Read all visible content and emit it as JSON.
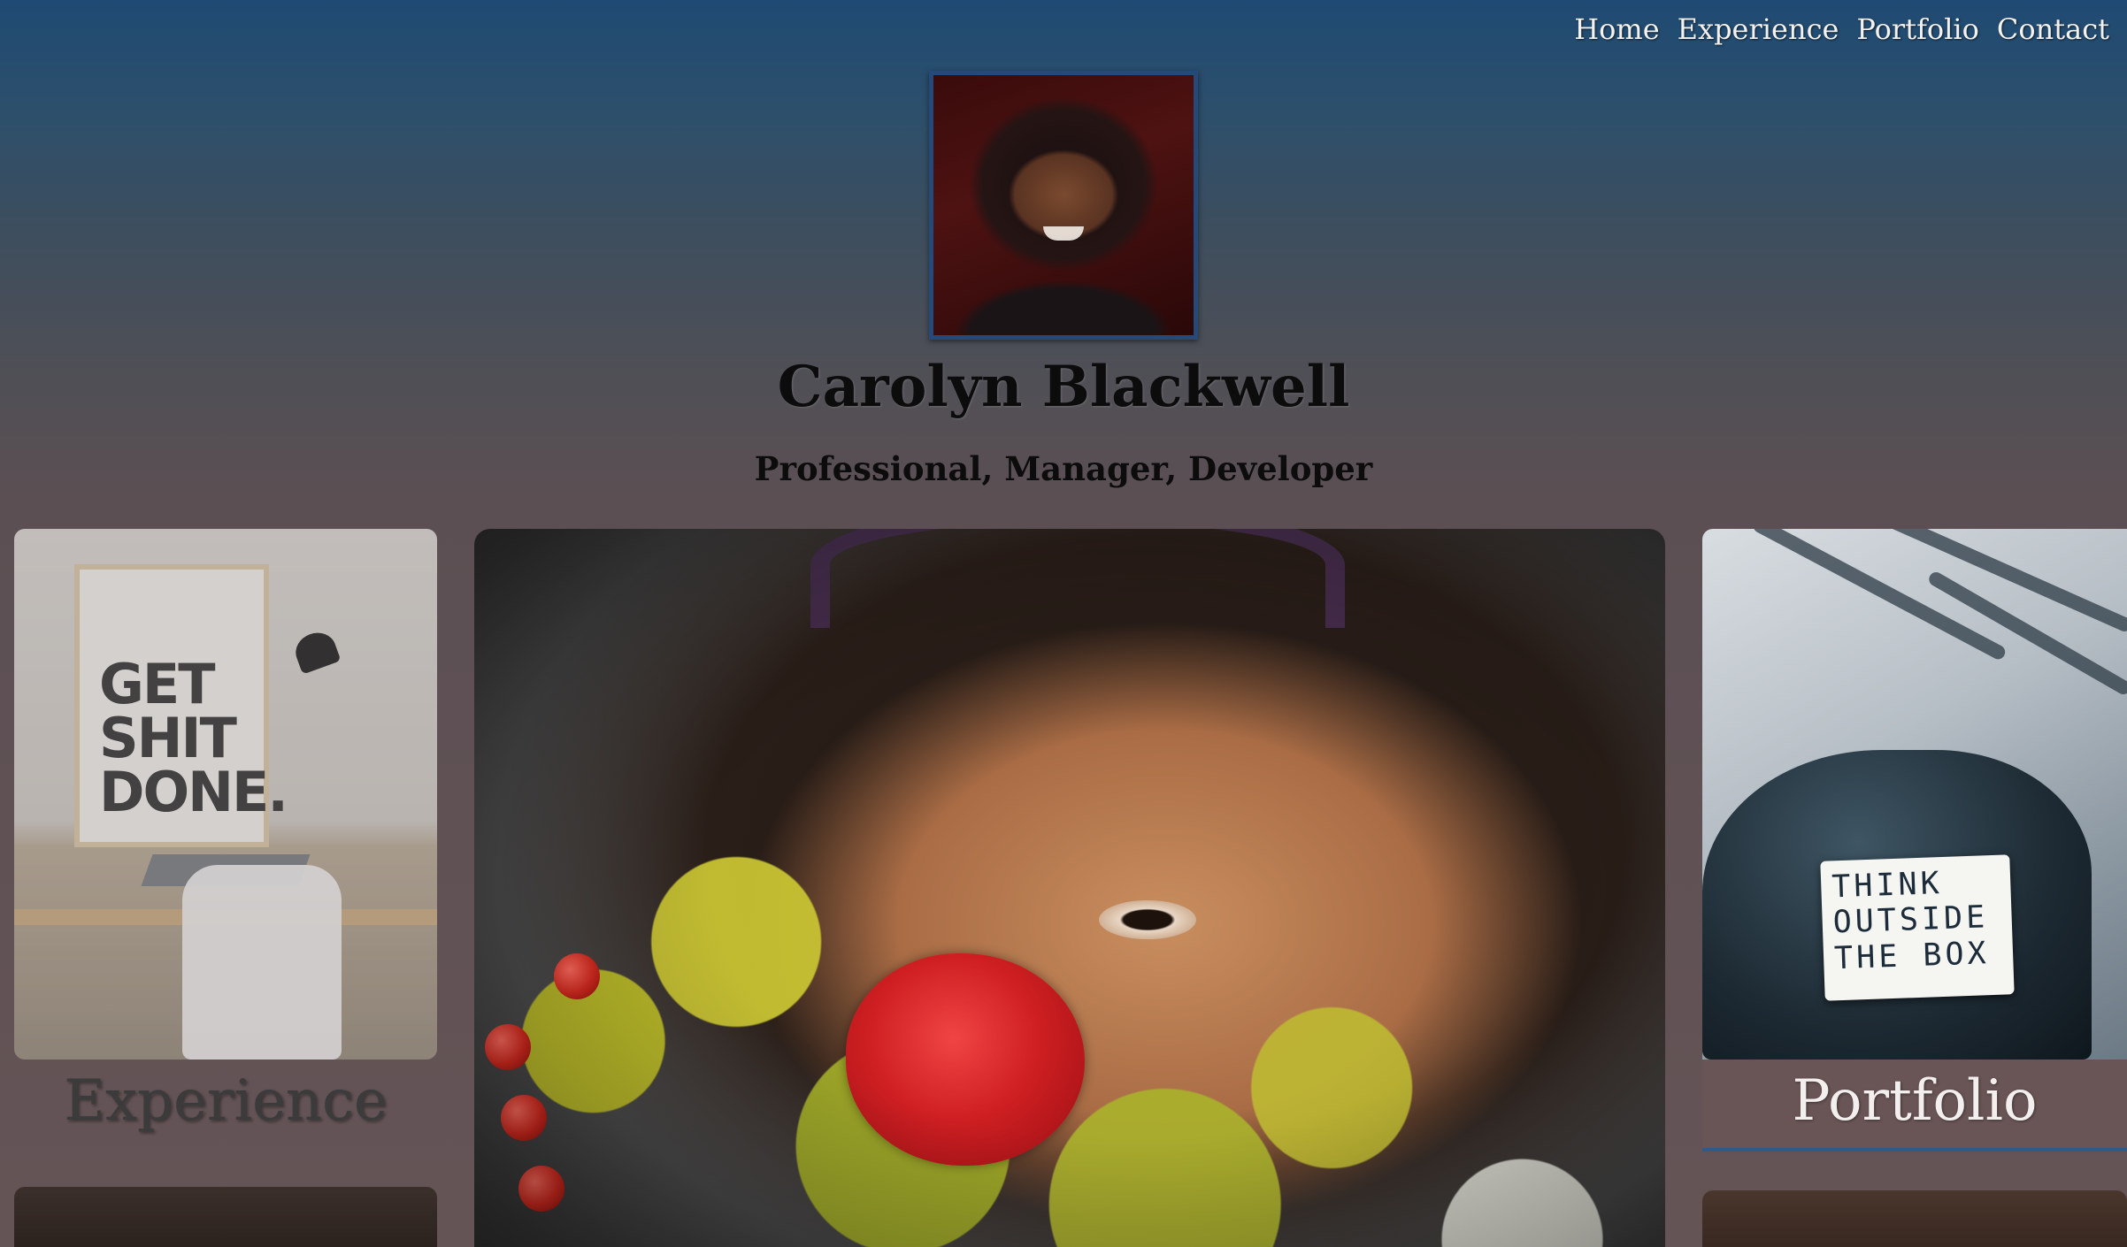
{
  "nav": {
    "items": [
      {
        "label": "Home"
      },
      {
        "label": "Experience"
      },
      {
        "label": "Portfolio"
      },
      {
        "label": "Contact"
      }
    ]
  },
  "profile": {
    "name": "Carolyn Blackwell",
    "tagline": "Professional, Manager, Developer",
    "avatar_icon": "profile-photo"
  },
  "cards": {
    "experience": {
      "label": "Experience",
      "poster_text": "GET SHIT DONE."
    },
    "portfolio": {
      "label": "Portfolio",
      "sign_text": "THINK OUTSIDE THE BOX"
    }
  },
  "colors": {
    "header_top": "#1f4a73",
    "header_bottom": "#5b4f53",
    "avatar_border": "#254a7a",
    "portfolio_label_bg": "#6a5556",
    "portfolio_accent": "#2d5b8a",
    "nav_text": "#f4f2ee"
  }
}
